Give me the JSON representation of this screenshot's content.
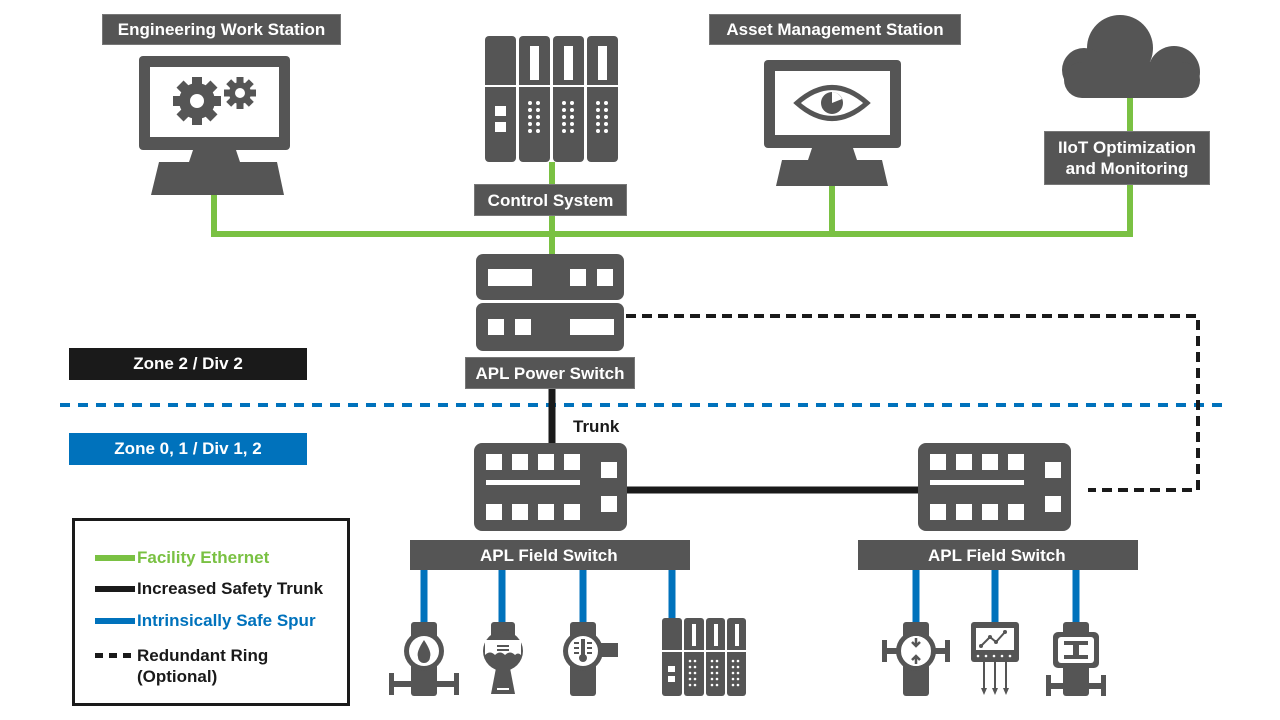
{
  "colors": {
    "device_gray": "#555555",
    "facility_ethernet": "#7ac143",
    "trunk": "#1a1a1a",
    "spur": "#0072bc",
    "zone_divider": "#0072bc",
    "zone2_bg": "#1a1a1a",
    "zone01_bg": "#0072bc"
  },
  "nodes": {
    "engineering_work_station": {
      "label": "Engineering Work Station",
      "icon": "monitor-gears-icon"
    },
    "control_system": {
      "label": "Control System",
      "icon": "controller-rack-icon"
    },
    "asset_management_station": {
      "label": "Asset Management Station",
      "icon": "monitor-eye-icon"
    },
    "iiot": {
      "label": "IIoT Optimization and Monitoring",
      "label_line1": "IIoT Optimization",
      "label_line2": "and Monitoring",
      "icon": "cloud-icon"
    },
    "apl_power_switch": {
      "label": "APL Power Switch",
      "icon": "power-switch-icon"
    },
    "apl_field_switch_1": {
      "label": "APL Field Switch",
      "icon": "field-switch-icon"
    },
    "apl_field_switch_2": {
      "label": "APL Field Switch",
      "icon": "field-switch-icon"
    }
  },
  "trunk_label": "Trunk",
  "zones": {
    "upper": "Zone 2 / Div 2",
    "lower": "Zone 0, 1 / Div 1, 2"
  },
  "field_devices": {
    "switch_1": [
      "flow-meter-icon",
      "level-transmitter-icon",
      "temperature-transmitter-icon",
      "remote-io-rack-icon"
    ],
    "switch_2": [
      "pressure-transmitter-icon",
      "analyzer-icon",
      "valve-positioner-icon"
    ]
  },
  "legend": {
    "items": [
      {
        "label": "Facility Ethernet",
        "style": "solid-green"
      },
      {
        "label": "Increased Safety Trunk",
        "style": "solid-black"
      },
      {
        "label": "Intrinsically Safe Spur",
        "style": "solid-blue"
      },
      {
        "label": "Redundant Ring",
        "label_line2": "(Optional)",
        "style": "dashed-black"
      }
    ]
  }
}
